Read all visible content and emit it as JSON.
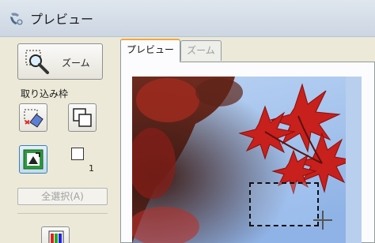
{
  "window": {
    "title": "プレビュー"
  },
  "toolbar": {
    "zoom_button_label": "ズーム",
    "frame_section_label": "取り込み枠",
    "frame_count": "1",
    "select_all_label": "全選択(A)"
  },
  "tabs": [
    {
      "label": "プレビュー",
      "active": true
    },
    {
      "label": "ズーム",
      "active": false
    }
  ],
  "colors": {
    "accent": "#f2a643",
    "leaf_red": "#c8201c",
    "sky_blue": "#a8c8f0"
  },
  "icons": {
    "app": "scanner-icon",
    "zoom": "magnifier-icon",
    "erase": "eraser-icon",
    "copy": "copy-frame-icon",
    "auto": "auto-locate-icon",
    "bottom": "color-adjust-icon"
  }
}
